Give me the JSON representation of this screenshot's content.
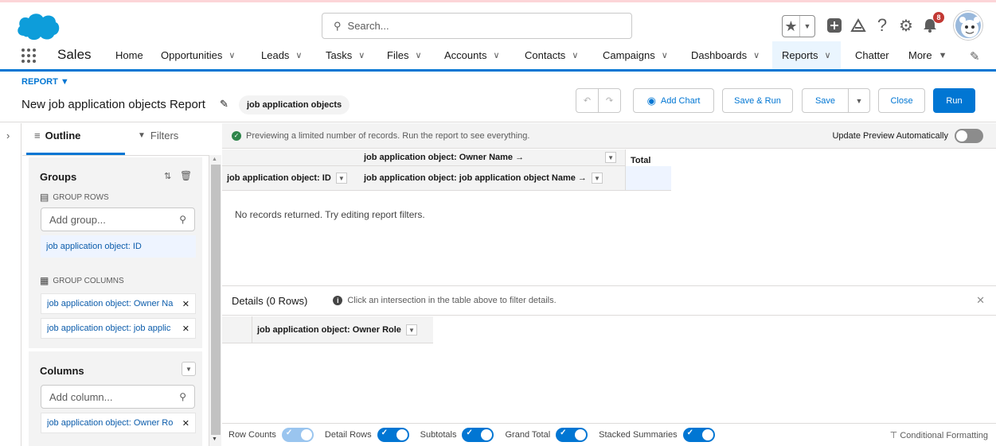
{
  "topbar": {
    "search_placeholder": "Search...",
    "notification_count": "8"
  },
  "nav": {
    "app_name": "Sales",
    "items": [
      {
        "label": "Home",
        "chevron": false
      },
      {
        "label": "Opportunities",
        "chevron": true
      },
      {
        "label": "Leads",
        "chevron": true
      },
      {
        "label": "Tasks",
        "chevron": true
      },
      {
        "label": "Files",
        "chevron": true
      },
      {
        "label": "Accounts",
        "chevron": true
      },
      {
        "label": "Contacts",
        "chevron": true
      },
      {
        "label": "Campaigns",
        "chevron": true
      },
      {
        "label": "Dashboards",
        "chevron": true
      },
      {
        "label": "Reports",
        "chevron": true,
        "active": true
      },
      {
        "label": "Chatter",
        "chevron": false
      },
      {
        "label": "More",
        "chevron": true
      }
    ]
  },
  "report": {
    "label": "REPORT",
    "title": "New job application objects Report",
    "type_badge": "job application objects",
    "buttons": {
      "add_chart": "Add Chart",
      "save_run": "Save & Run",
      "save": "Save",
      "close": "Close",
      "run": "Run"
    }
  },
  "outline": {
    "tab_outline": "Outline",
    "tab_filters": "Filters",
    "groups_title": "Groups",
    "group_rows_label": "GROUP ROWS",
    "add_group_placeholder": "Add group...",
    "group_rows": [
      "job application object: ID"
    ],
    "group_columns_label": "GROUP COLUMNS",
    "group_columns": [
      "job application object: Owner Na",
      "job application object: job applic"
    ],
    "columns_title": "Columns",
    "add_column_placeholder": "Add column...",
    "columns": [
      "job application object: Owner Ro"
    ]
  },
  "preview": {
    "notice": "Previewing a limited number of records. Run the report to see everything.",
    "update_label": "Update Preview Automatically",
    "col_group_1": "job application object: Owner Name →",
    "row_group": "job application object: ID",
    "col_group_2": "job application object: job application object Name →",
    "total_label": "Total",
    "empty_message": "No records returned. Try editing report filters.",
    "details_title": "Details (0 Rows)",
    "details_hint": "Click an intersection in the table above to filter details.",
    "details_column": "job application object: Owner Role"
  },
  "footer": {
    "row_counts": "Row Counts",
    "detail_rows": "Detail Rows",
    "subtotals": "Subtotals",
    "grand_total": "Grand Total",
    "stacked_summaries": "Stacked Summaries",
    "conditional_formatting": "Conditional Formatting"
  }
}
